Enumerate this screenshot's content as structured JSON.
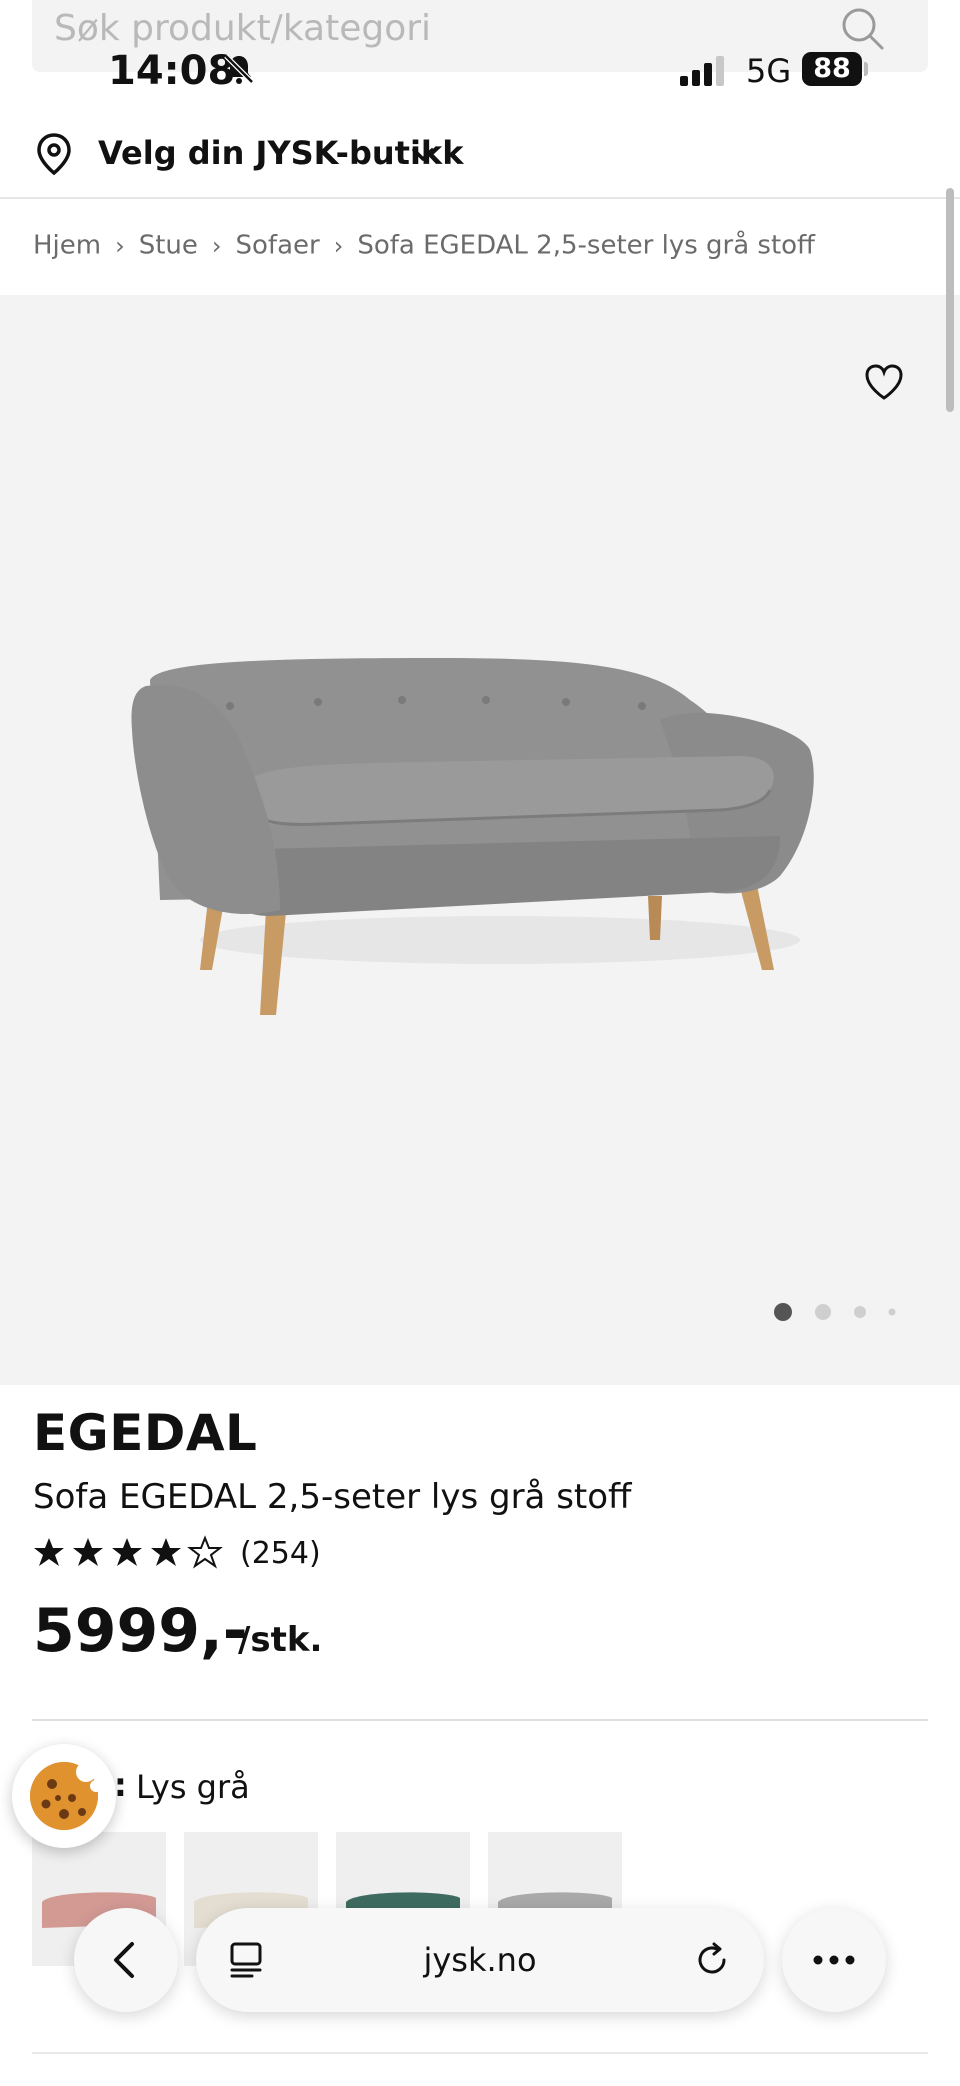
{
  "search": {
    "placeholder": "Søk produkt/kategori"
  },
  "status_bar": {
    "time": "14:08",
    "network": "5G",
    "battery": "88"
  },
  "store_selector": {
    "label": "Velg din JYSK-butikk"
  },
  "breadcrumb": [
    "Hjem",
    "Stue",
    "Sofaer",
    "Sofa EGEDAL 2,5-seter lys grå stoff"
  ],
  "gallery": {
    "image_count": 4,
    "active_index": 0
  },
  "product": {
    "brand": "EGEDAL",
    "name": "Sofa EGEDAL 2,5-seter lys grå stoff",
    "rating": 4.5,
    "review_count": "(254)",
    "price": "5999,-",
    "unit": "/stk."
  },
  "color": {
    "label": "Lys grå"
  },
  "swatches": [
    "rosa",
    "kremhvit",
    "grønn",
    "lys grå"
  ],
  "browser": {
    "url": "jysk.no"
  },
  "colors": {
    "sofa": "#8f8f8f",
    "image_bg": "#f3f3f3",
    "legs": "#c79b63"
  }
}
